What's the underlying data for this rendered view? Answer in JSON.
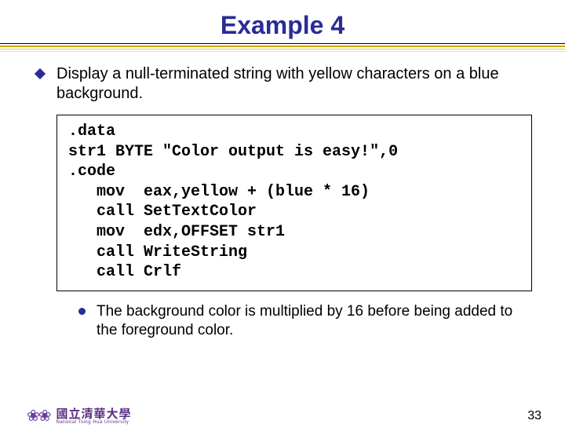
{
  "title": "Example 4",
  "main_bullet": "Display a null-terminated string with yellow characters on a blue background.",
  "code": ".data\nstr1 BYTE \"Color output is easy!\",0\n.code\n   mov  eax,yellow + (blue * 16)\n   call SetTextColor\n   mov  edx,OFFSET str1\n   call WriteString\n   call Crlf",
  "sub_bullet": "The background color is multiplied by 16 before being added to the foreground color.",
  "footer": {
    "org_cn": "國立清華大學",
    "org_en": "National Tsing Hua University",
    "page": "33"
  }
}
